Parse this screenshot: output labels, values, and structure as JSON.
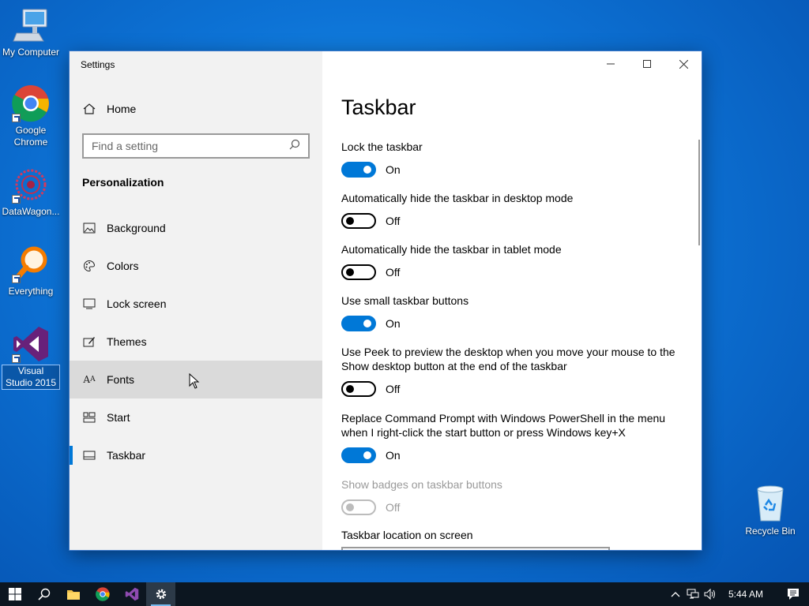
{
  "desktop": {
    "icons": [
      {
        "label": "My Computer"
      },
      {
        "label": "Google Chrome"
      },
      {
        "label": "DataWagon..."
      },
      {
        "label": "Everything"
      },
      {
        "label": "Visual Studio 2015"
      }
    ],
    "recycle_bin": "Recycle Bin"
  },
  "window": {
    "title": "Settings",
    "sidebar": {
      "home": "Home",
      "search_placeholder": "Find a setting",
      "section": "Personalization",
      "items": [
        {
          "label": "Background"
        },
        {
          "label": "Colors"
        },
        {
          "label": "Lock screen"
        },
        {
          "label": "Themes"
        },
        {
          "label": "Fonts"
        },
        {
          "label": "Start"
        },
        {
          "label": "Taskbar"
        }
      ]
    },
    "page_title": "Taskbar",
    "settings": [
      {
        "name": "Lock the taskbar",
        "state": "On"
      },
      {
        "name": "Automatically hide the taskbar in desktop mode",
        "state": "Off"
      },
      {
        "name": "Automatically hide the taskbar in tablet mode",
        "state": "Off"
      },
      {
        "name": "Use small taskbar buttons",
        "state": "On"
      },
      {
        "name": "Use Peek to preview the desktop when you move your mouse to the Show desktop button at the end of the taskbar",
        "state": "Off"
      },
      {
        "name": "Replace Command Prompt with Windows PowerShell in the menu when I right-click the start button or press Windows key+X",
        "state": "On"
      },
      {
        "name": "Show badges on taskbar buttons",
        "state": "Off"
      }
    ],
    "location_label": "Taskbar location on screen"
  },
  "taskbar": {
    "clock": "5:44 AM"
  },
  "colors": {
    "accent": "#0078d7",
    "taskbar": "#0c1620",
    "sidebar": "#f2f2f2"
  }
}
